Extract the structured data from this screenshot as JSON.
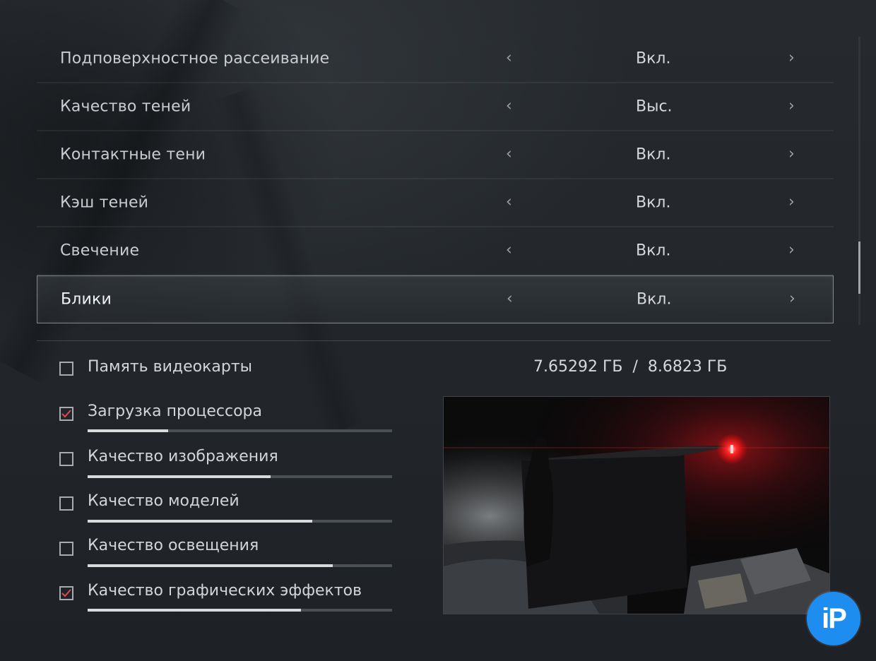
{
  "settings": [
    {
      "label": "Подповерхностное рассеивание",
      "value": "Вкл.",
      "selected": false
    },
    {
      "label": "Качество теней",
      "value": "Выс.",
      "selected": false
    },
    {
      "label": "Контактные тени",
      "value": "Вкл.",
      "selected": false
    },
    {
      "label": "Кэш теней",
      "value": "Вкл.",
      "selected": false
    },
    {
      "label": "Свечение",
      "value": "Вкл.",
      "selected": false
    },
    {
      "label": "Блики",
      "value": "Вкл.",
      "selected": true
    }
  ],
  "arrows": {
    "left": "‹",
    "right": "›"
  },
  "vram": {
    "label": "Память видеокарты",
    "checked": false,
    "used": "7.65292 ГБ",
    "separator": "/",
    "total": "8.6823 ГБ"
  },
  "meters": [
    {
      "label": "Загрузка процессора",
      "checked": true,
      "level": 0.265
    },
    {
      "label": "Качество изображения",
      "checked": false,
      "level": 0.6
    },
    {
      "label": "Качество моделей",
      "checked": false,
      "level": 0.737
    },
    {
      "label": "Качество освещения",
      "checked": false,
      "level": 0.805
    },
    {
      "label": "Качество графических эффектов",
      "checked": true,
      "level": 0.7
    }
  ],
  "colors": {
    "check_mark": "#e0484a",
    "accent_light": "#d8dadc",
    "logo_blue": "#1d8df0"
  },
  "logo": {
    "text": "iP"
  }
}
